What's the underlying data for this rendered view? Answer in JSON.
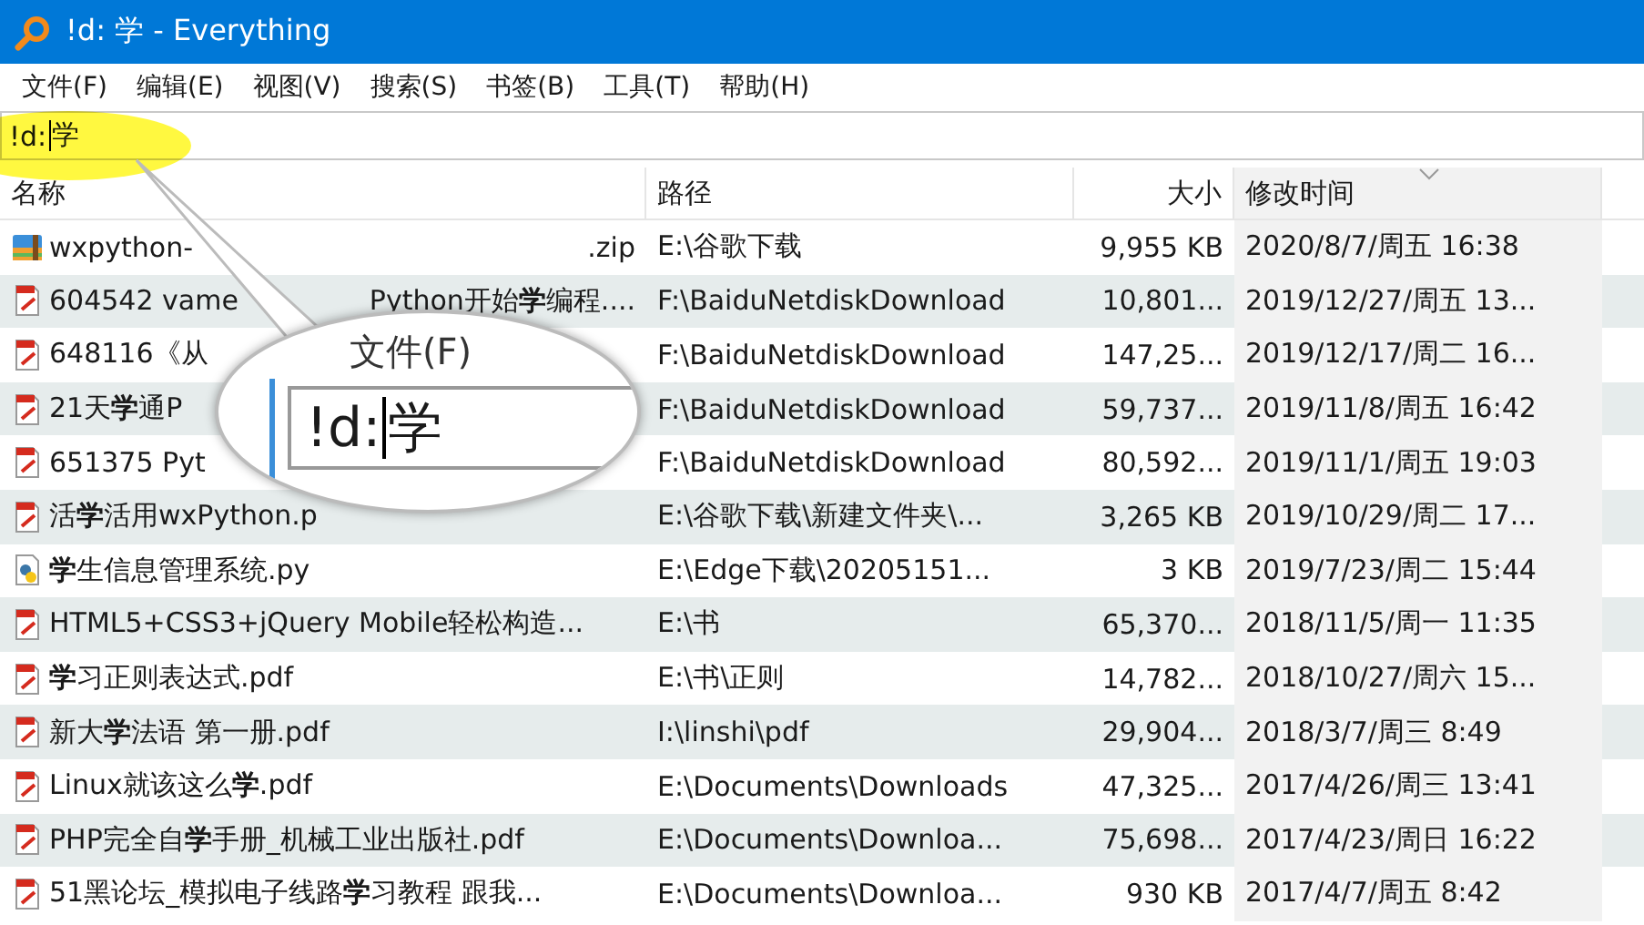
{
  "window": {
    "title": "!d: 学 - Everything"
  },
  "menu": [
    "文件(F)",
    "编辑(E)",
    "视图(V)",
    "搜索(S)",
    "书签(B)",
    "工具(T)",
    "帮助(H)"
  ],
  "search": {
    "value_before_caret": "!d:",
    "value_after_caret": "学"
  },
  "columns": [
    {
      "label": "名称",
      "sorted": false
    },
    {
      "label": "路径",
      "sorted": false
    },
    {
      "label": "大小",
      "sorted": false
    },
    {
      "label": "修改时间",
      "sorted": true
    }
  ],
  "rows": [
    {
      "kind": "zip",
      "name": "wxpython-",
      "name_end": ".zip",
      "path": "E:\\谷歌下载",
      "size": "9,955 KB",
      "modified": "2020/8/7/周五 16:38"
    },
    {
      "kind": "pdf",
      "name": "604542 vame",
      "name_end": "Python开始**学**编程....",
      "path": "F:\\BaiduNetdiskDownload",
      "size": "10,801...",
      "modified": "2019/12/27/周五 13..."
    },
    {
      "kind": "pdf",
      "name": "648116《从",
      "path": "F:\\BaiduNetdiskDownload",
      "size": "147,25...",
      "modified": "2019/12/17/周二 16..."
    },
    {
      "kind": "pdf",
      "name": "21天**学**通P",
      "path": "F:\\BaiduNetdiskDownload",
      "size": "59,737...",
      "modified": "2019/11/8/周五 16:42"
    },
    {
      "kind": "pdf",
      "name": "651375 Pyt",
      "path": "F:\\BaiduNetdiskDownload",
      "size": "80,592...",
      "modified": "2019/11/1/周五 19:03"
    },
    {
      "kind": "pdf",
      "name": "活**学**活用wxPython.p",
      "path": "E:\\谷歌下载\\新建文件夹\\...",
      "size": "3,265 KB",
      "modified": "2019/10/29/周二 17..."
    },
    {
      "kind": "py",
      "name": "**学**生信息管理系统.py",
      "path": "E:\\Edge下载\\20205151...",
      "size": "3 KB",
      "modified": "2019/7/23/周二 15:44"
    },
    {
      "kind": "pdf",
      "name": "HTML5+CSS3+jQuery Mobile轻松构造...",
      "path": "E:\\书",
      "size": "65,370...",
      "modified": "2018/11/5/周一 11:35"
    },
    {
      "kind": "pdf",
      "name": "**学**习正则表达式.pdf",
      "path": "E:\\书\\正则",
      "size": "14,782...",
      "modified": "2018/10/27/周六 15..."
    },
    {
      "kind": "pdf",
      "name": "新大**学**法语 第一册.pdf",
      "path": "I:\\linshi\\pdf",
      "size": "29,904...",
      "modified": "2018/3/7/周三 8:49"
    },
    {
      "kind": "pdf",
      "name": "Linux就该这么**学**.pdf",
      "path": "E:\\Documents\\Downloads",
      "size": "47,325...",
      "modified": "2017/4/26/周三 13:41"
    },
    {
      "kind": "pdf",
      "name": "PHP完全自**学**手册_机械工业出版社.pdf",
      "path": "E:\\Documents\\Downloa...",
      "size": "75,698...",
      "modified": "2017/4/23/周日 16:22"
    },
    {
      "kind": "pdf",
      "name": "51黑论坛_模拟电子线路**学**习教程 跟我...",
      "path": "E:\\Documents\\Downloa...",
      "size": "930 KB",
      "modified": "2017/4/7/周五 8:42"
    }
  ],
  "callout": {
    "menu_text": "文件(F)",
    "value_before_caret": "!d:",
    "value_after_caret": "学"
  }
}
